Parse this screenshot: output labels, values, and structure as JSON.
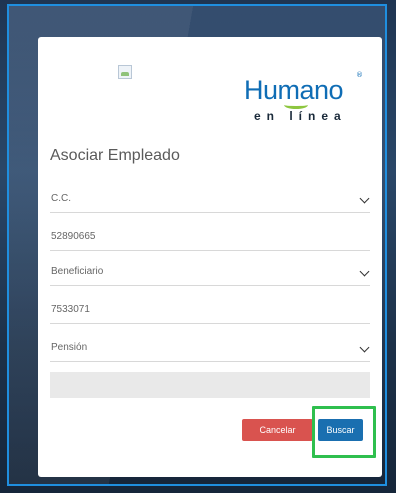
{
  "logo": {
    "main": "Humano",
    "registered": "®",
    "sub": "en línea"
  },
  "form": {
    "title": "Asociar Empleado",
    "doc_type": "C.C.",
    "doc_number": "52890665",
    "relation": "Beneficiario",
    "code": "7533071",
    "category": "Pensión",
    "extra_value": ""
  },
  "buttons": {
    "cancel": "Cancelar",
    "search": "Buscar"
  },
  "colors": {
    "primary": "#1a6fb0",
    "danger": "#d9534f",
    "highlight": "#2fbf4e",
    "frame": "#1f8fe0"
  }
}
